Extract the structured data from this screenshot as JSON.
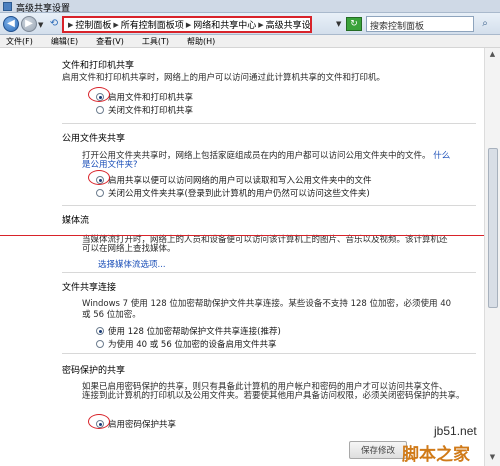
{
  "window": {
    "title": "高级共享设置"
  },
  "address": {
    "crumbs": [
      "控制面板",
      "所有控制面板项",
      "网络和共享中心",
      "高级共享设置"
    ],
    "search_placeholder": "搜索控制面板"
  },
  "menu": [
    "文件(F)",
    "编辑(E)",
    "查看(V)",
    "工具(T)",
    "帮助(H)"
  ],
  "sections": {
    "printer": {
      "heading": "文件和打印机共享",
      "desc": "启用文件和打印机共享时，网络上的用户可以访问通过此计算机共享的文件和打印机。",
      "opt_on": "启用文件和打印机共享",
      "opt_off": "关闭文件和打印机共享",
      "selected": "on"
    },
    "public": {
      "heading": "公用文件夹共享",
      "desc_line1": "打开公用文件夹共享时，网络上包括家庭组成员在内的用户都可以访问公用文件夹中的文件。",
      "desc_link": "什么是公用文件夹?",
      "desc_link_a": "什么",
      "desc_link_b": "是公用文件夹?",
      "opt_on": "启用共享以便可以访问网络的用户可以读取和写入公用文件夹中的文件",
      "opt_off": "关闭公用文件夹共享(登录到此计算机的用户仍然可以访问这些文件夹)",
      "selected": "on"
    },
    "media": {
      "heading": "媒体流",
      "desc_line1": "当媒体流打开时，网络上的人员和设备便可以访问该计算机上的图片、音乐以及视频。该计算机还",
      "desc_line2": "可以在网络上查找媒体。",
      "link": "选择媒体流选项..."
    },
    "connection": {
      "heading": "文件共享连接",
      "desc_line1": "Windows 7 使用 128 位加密帮助保护文件共享连接。某些设备不支持 128 位加密，必须使用 40",
      "desc_line2": "或 56 位加密。",
      "opt_128": "使用 128 位加密帮助保护文件共享连接(推荐)",
      "opt_40": "为使用 40 或 56 位加密的设备启用文件共享",
      "selected": "128"
    },
    "password": {
      "heading": "密码保护的共享",
      "desc_line1": "如果已启用密码保护的共享，则只有具备此计算机的用户帐户和密码的用户才可以访问共享文件、",
      "desc_line2": "连接到此计算机的打印机以及公用文件夹。若要使其他用户具备访问权限，必须关闭密码保护的共享。",
      "opt_on": "启用密码保护共享",
      "selected": "on"
    }
  },
  "footer": {
    "save_label": "保存修改"
  },
  "watermark": {
    "site": "jb51.net",
    "brand": "脚本之家"
  },
  "colors": {
    "highlight_red": "#d8232a",
    "link_blue": "#1b4fb8",
    "watermark_orange": "#d07a18"
  }
}
